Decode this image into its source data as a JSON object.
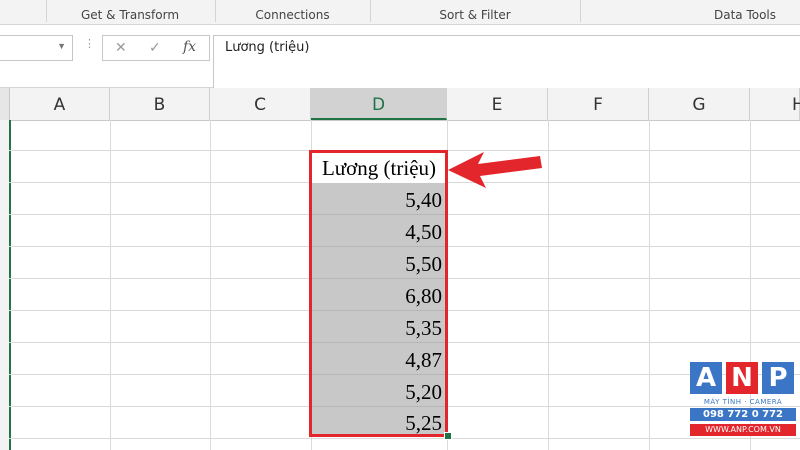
{
  "ribbon": {
    "groups": [
      "Get & Transform",
      "Connections",
      "Sort & Filter",
      "Data Tools"
    ]
  },
  "formula_bar": {
    "name_box_value": "",
    "cancel_icon": "✕",
    "enter_icon": "✓",
    "fx_label": "fx",
    "content": "Lương (triệu)"
  },
  "columns": [
    "A",
    "B",
    "C",
    "D",
    "E",
    "F",
    "G",
    "H"
  ],
  "selected_column": "D",
  "data_column": {
    "header": "Lương (triệu)",
    "values": [
      "5,40",
      "4,50",
      "5,50",
      "6,80",
      "5,35",
      "4,87",
      "5,20",
      "5,25"
    ]
  },
  "annotation": {
    "arrow_color": "#e3262b",
    "icon": "red-arrow-icon"
  },
  "colors": {
    "accent_green": "#217346",
    "selection_red": "#e3262b",
    "selected_fill": "#c8c8c8"
  },
  "watermark": {
    "letters": [
      "A",
      "N",
      "P"
    ],
    "tagline": "MÁY TÍNH · CAMERA",
    "phone": "098 772 0 772",
    "url": "WWW.ANP.COM.VN"
  }
}
